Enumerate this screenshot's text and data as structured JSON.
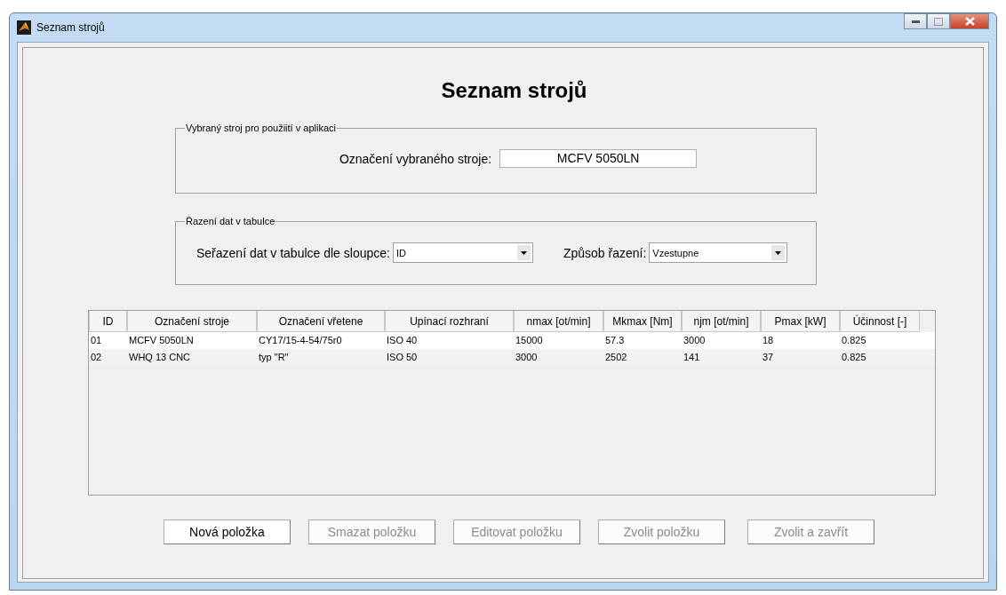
{
  "window": {
    "title": "Seznam strojů"
  },
  "heading": "Seznam strojů",
  "selected_panel": {
    "title": "Vybraný stroj pro použiití v aplikaci",
    "label": "Označení vybraného stroje:",
    "value": "MCFV 5050LN"
  },
  "sort_panel": {
    "title": "Řazení dat v tabulce",
    "column_label": "Seřazení dat v tabulce dle sloupce:",
    "column_value": "ID",
    "order_label": "Způsob řazení:",
    "order_value": "Vzestupne"
  },
  "table": {
    "columns": [
      "ID",
      "Označení stroje",
      "Označení vřetene",
      "Upínací rozhraní",
      "nmax [ot/min]",
      "Mkmax [Nm]",
      "njm [ot/min]",
      "Pmax [kW]",
      "Účinnost [-]"
    ],
    "rows": [
      {
        "cells": [
          "01",
          "MCFV 5050LN",
          "CY17/15-4-54/75r0",
          "ISO 40",
          "15000",
          "57.3",
          "3000",
          "18",
          "0.825"
        ]
      },
      {
        "cells": [
          "02",
          "WHQ 13 CNC",
          "typ \"R\"",
          "ISO 50",
          "3000",
          "2502",
          "141",
          "37",
          "0.825"
        ]
      }
    ]
  },
  "buttons": [
    {
      "label": "Nová položka",
      "disabled": false
    },
    {
      "label": "Smazat položku",
      "disabled": true
    },
    {
      "label": "Editovat položku",
      "disabled": true
    },
    {
      "label": "Zvolit položku",
      "disabled": true
    },
    {
      "label": "Zvolit a zavřít",
      "disabled": true
    }
  ]
}
